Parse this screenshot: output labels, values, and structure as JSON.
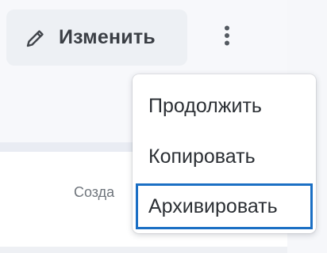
{
  "toolbar": {
    "edit_label": "Изменить",
    "edit_icon": "pencil-icon",
    "more_icon": "vertical-dots-icon"
  },
  "content": {
    "created_label": "Созда"
  },
  "menu": {
    "items": [
      {
        "label": "Продолжить"
      },
      {
        "label": "Копировать"
      },
      {
        "label": "Архивировать",
        "focused": true
      }
    ],
    "focus_color": "#1b6fc4"
  }
}
